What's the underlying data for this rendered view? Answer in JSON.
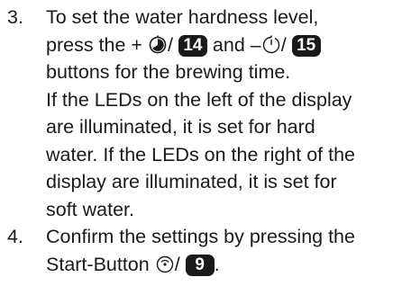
{
  "steps": [
    {
      "number": "3.",
      "line1": "To set the water hardness level,",
      "line2": {
        "pre": "press the +",
        "sep1": "/",
        "badge1": "14",
        "mid": "and –",
        "sep2": "/",
        "badge2": "15"
      },
      "line3": "buttons for the brewing time.",
      "line4": "If the LEDs on the left of the display",
      "line5": "are illuminated, it is set for hard",
      "line6": "water. If the LEDs on the right of the",
      "line7": "display are illuminated, it is set for",
      "line8": "soft water."
    },
    {
      "number": "4.",
      "line1": "Confirm the settings by pressing the",
      "line2": {
        "pre": "Start-Button",
        "sep": "/",
        "badge": "9",
        "post": "."
      }
    }
  ],
  "icons": {
    "increase": "timer-filled-icon",
    "decrease": "timer-outline-icon",
    "start": "start-button-icon"
  }
}
